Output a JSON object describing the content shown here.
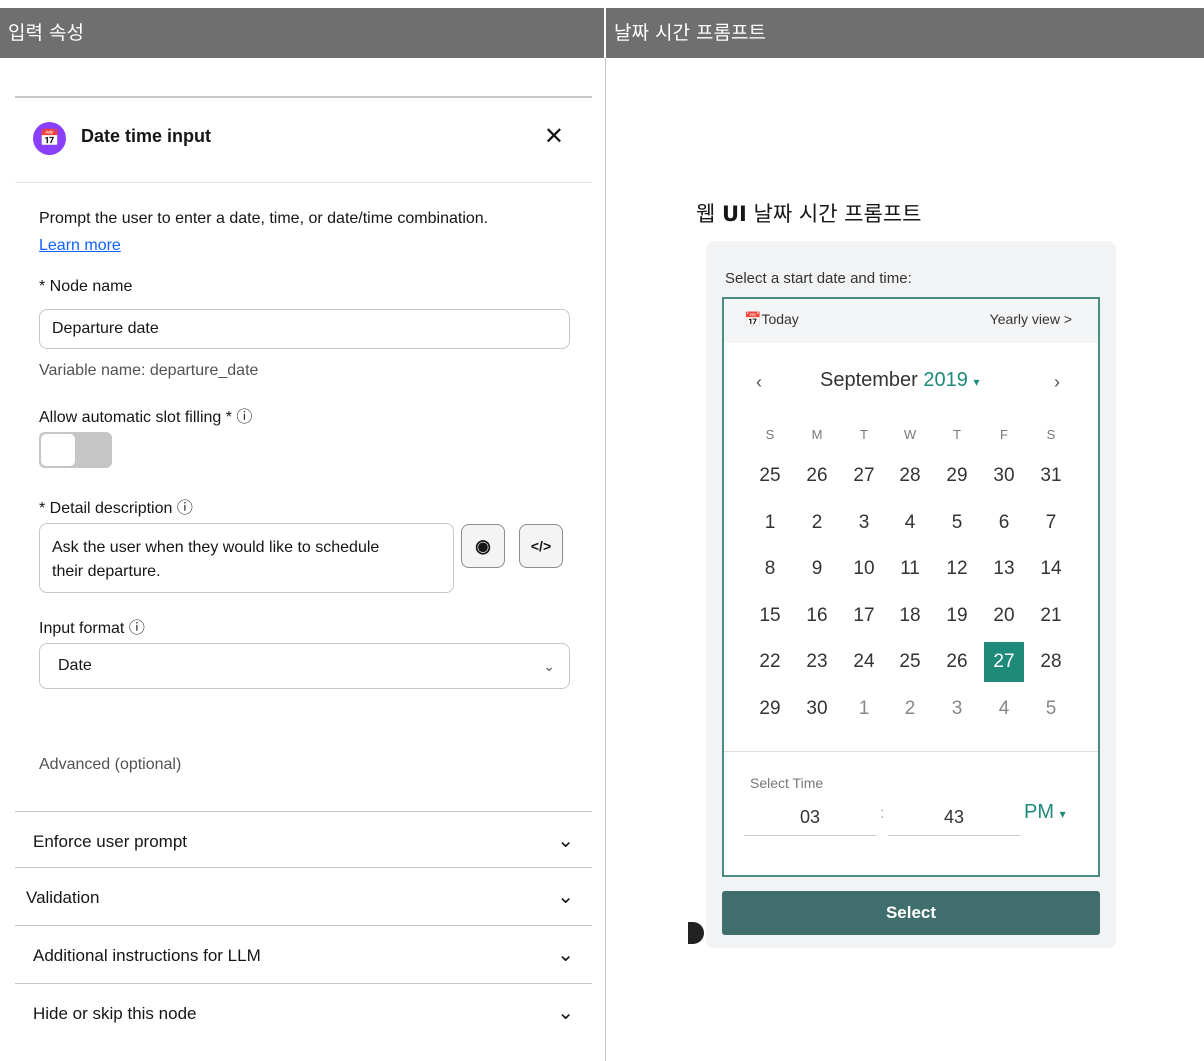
{
  "header": {
    "left_title": "입력 속성",
    "right_title": "날짜 시간 프롬프트"
  },
  "panel": {
    "title": "Date time input",
    "node_icon": "calendar-icon",
    "close_icon": "close-icon",
    "description": "Prompt the user to enter a date, time, or date/time combination.",
    "learn_more": "Learn more",
    "node_name_label": "* Node name",
    "node_name_value": "Departure date",
    "variable_name": "Variable name: departure_date",
    "slot_filling_label": "Allow automatic slot filling * ⓘ",
    "slot_filling_on": false,
    "detail_label": "* Detail description  ⓘ",
    "detail_value": "Ask the user when they would like to schedule their departure.",
    "input_format_label": "Input format  ⓘ",
    "input_format_value": "Date",
    "advanced_label": "Advanced (optional)",
    "accordions": [
      {
        "label": "Enforce user prompt"
      },
      {
        "label": "Validation"
      },
      {
        "label": "Additional instructions for LLM"
      },
      {
        "label": "Hide or skip this node"
      }
    ]
  },
  "preview": {
    "title_prefix": "웹 ",
    "title_bold": "UI",
    "title_suffix": " 날짜 시간 프롬프트",
    "label": "Select a start date and time:",
    "today": "Today",
    "yearly_view": "Yearly view >",
    "month": "September",
    "year": "2019",
    "weekdays": [
      "S",
      "M",
      "T",
      "W",
      "T",
      "F",
      "S"
    ],
    "weeks": [
      [
        "25",
        "26",
        "27",
        "28",
        "29",
        "30",
        "31"
      ],
      [
        "1",
        "2",
        "3",
        "4",
        "5",
        "6",
        "7"
      ],
      [
        "8",
        "9",
        "10",
        "11",
        "12",
        "13",
        "14"
      ],
      [
        "15",
        "16",
        "17",
        "18",
        "19",
        "20",
        "21"
      ],
      [
        "22",
        "23",
        "24",
        "25",
        "26",
        "27",
        "28"
      ],
      [
        "29",
        "30",
        "1",
        "2",
        "3",
        "4",
        "5"
      ]
    ],
    "selected_day": "27",
    "time_label": "Select Time",
    "hour": "03",
    "minute": "43",
    "ampm": "PM",
    "select_button": "Select",
    "accent_color": "#1e8a7a",
    "button_color": "#3f6e6c"
  }
}
